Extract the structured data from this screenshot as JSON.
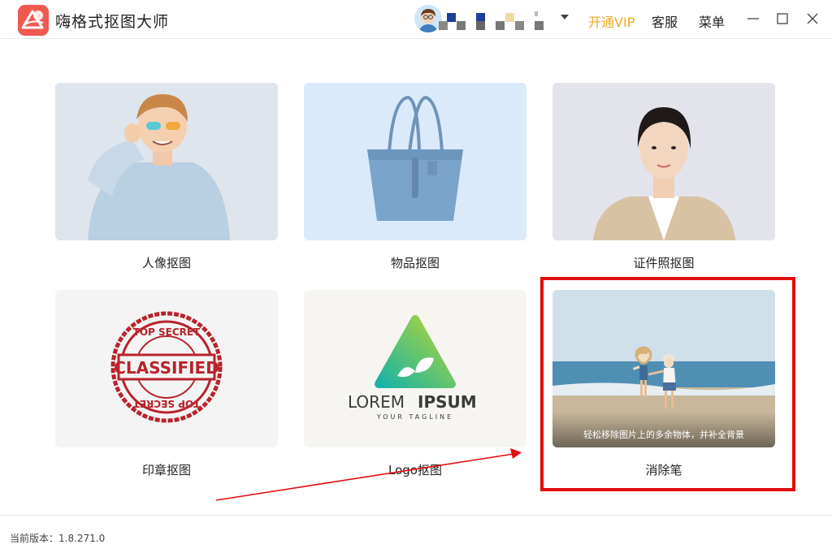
{
  "app": {
    "title": "嗨格式抠图大师"
  },
  "header": {
    "vip_label": "开通VIP",
    "service_label": "客服",
    "menu_label": "菜单"
  },
  "colors": {
    "brand": "#ee5a4e",
    "vip": "#f5a623",
    "highlight": "#e30c0c",
    "arrow": "#e30c0c"
  },
  "tools": [
    {
      "label": "人像抠图"
    },
    {
      "label": "物品抠图"
    },
    {
      "label": "证件照抠图"
    },
    {
      "label": "印章抠图",
      "image_text": {
        "top": "TOP SECRET",
        "middle": "CLASSIFIED",
        "bottom": "TOP SECRET"
      }
    },
    {
      "label": "Logo抠图",
      "image_text": {
        "brand": "LOREM",
        "brand_bold": "IPSUM",
        "tagline": "YOUR TAGLINE"
      }
    },
    {
      "label": "消除笔",
      "overlay": "轻松移除图片上的多余物体，并补全背景"
    }
  ],
  "footer": {
    "version": "当前版本：1.8.271.0"
  }
}
